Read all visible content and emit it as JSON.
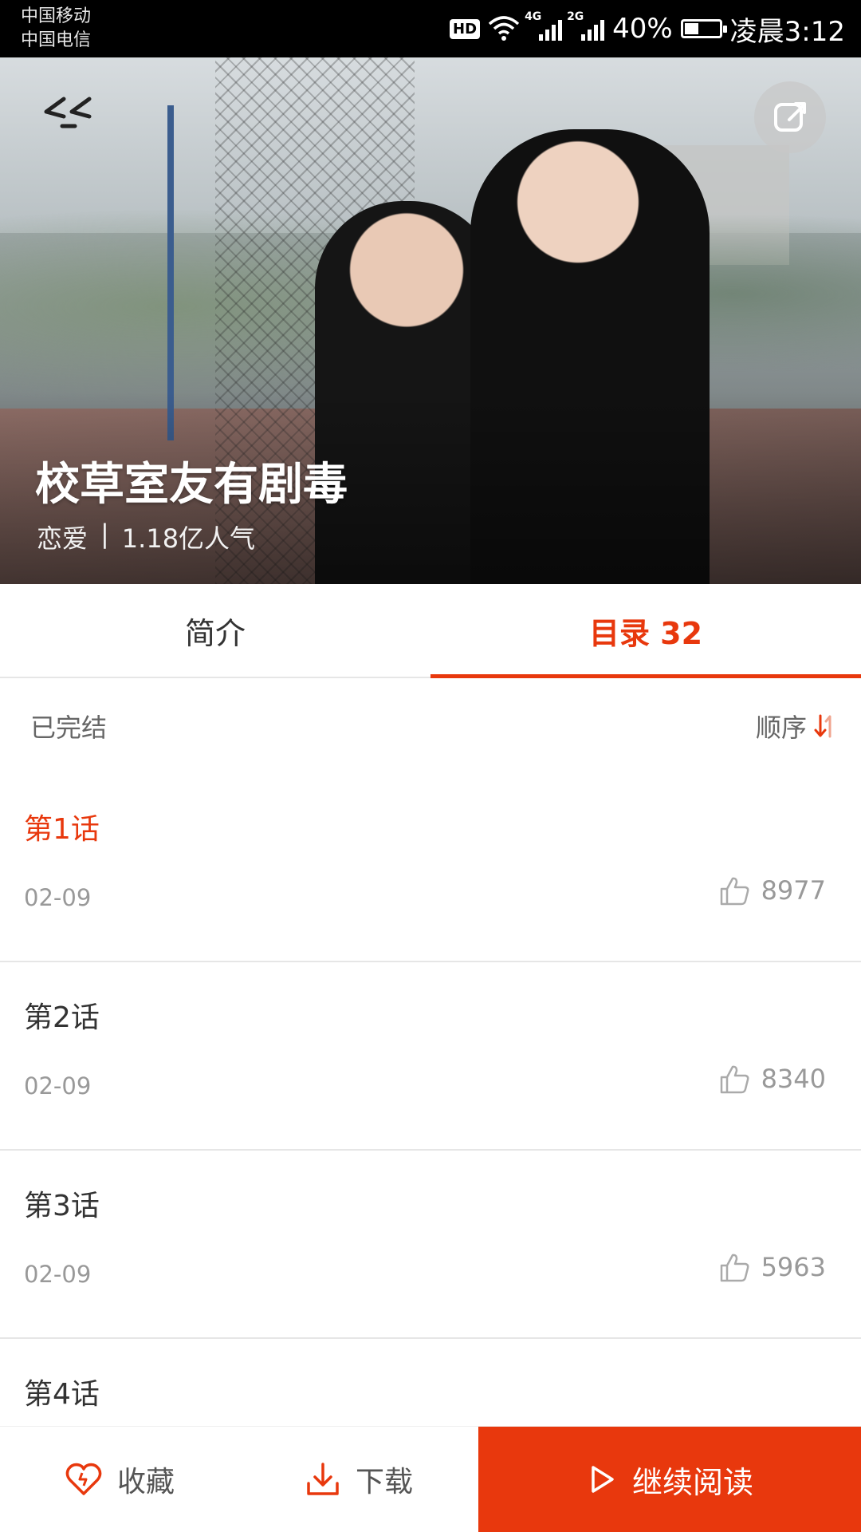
{
  "status_bar": {
    "carrier_1": "中国移动",
    "carrier_2": "中国电信",
    "hd": "HD",
    "net_1": "4G",
    "net_2": "2G",
    "battery": "40%",
    "battery_level": 0.4,
    "time": "凌晨3:12"
  },
  "hero": {
    "title": "校草室友有剧毒",
    "genre": "恋爱",
    "separator": "|",
    "popularity": "1.18亿人气",
    "back_icon": "back-arrows-icon",
    "share_icon": "share-icon"
  },
  "tabs": [
    {
      "label": "简介"
    },
    {
      "label": "目录 32"
    }
  ],
  "list_header": {
    "status": "已完结",
    "sort_label": "顺序",
    "sort_icon": "sort-arrows-icon"
  },
  "chapters": [
    {
      "title": "第1话",
      "date": "02-09",
      "likes": "8977"
    },
    {
      "title": "第2话",
      "date": "02-09",
      "likes": "8340"
    },
    {
      "title": "第3话",
      "date": "02-09",
      "likes": "5963"
    },
    {
      "title": "第4话",
      "date": "",
      "likes": ""
    }
  ],
  "bottom_bar": {
    "favorite": "收藏",
    "download": "下载",
    "continue_read": "继续阅读"
  },
  "colors": {
    "accent": "#e8380d",
    "text": "#333333",
    "muted": "#999999"
  }
}
